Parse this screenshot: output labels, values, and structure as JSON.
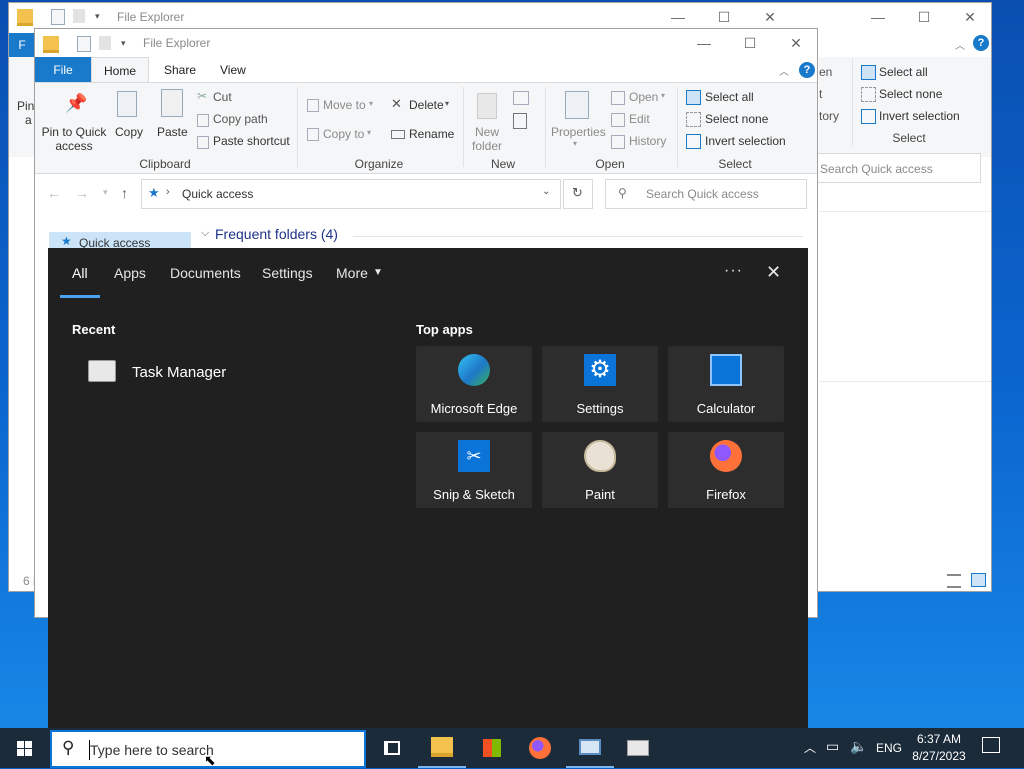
{
  "back_window": {
    "title": "File Explorer",
    "select_group": {
      "select_all": "Select all",
      "select_none": "Select none",
      "invert_selection": "Invert selection",
      "group_label": "Select"
    },
    "search_placeholder": "Search Quick access",
    "partial": {
      "file_tab": "F",
      "pin_part": "Pin",
      "pin_part2": "a",
      "en": "en",
      "t": "t",
      "tory": "tory",
      "status": "6 i"
    }
  },
  "front_window": {
    "title": "File Explorer",
    "tabs": [
      "File",
      "Home",
      "Share",
      "View"
    ],
    "ribbon": {
      "clipboard": {
        "pin": "Pin to Quick access",
        "copy": "Copy",
        "paste": "Paste",
        "cut": "Cut",
        "copy_path": "Copy path",
        "paste_shortcut": "Paste shortcut",
        "label": "Clipboard"
      },
      "organize": {
        "move_to": "Move to",
        "copy_to": "Copy to",
        "delete": "Delete",
        "rename": "Rename",
        "label": "Organize"
      },
      "new": {
        "new_folder": "New folder",
        "label": "New"
      },
      "open": {
        "properties": "Properties",
        "open": "Open",
        "edit": "Edit",
        "history": "History",
        "label": "Open"
      },
      "select": {
        "select_all": "Select all",
        "select_none": "Select none",
        "invert_selection": "Invert selection",
        "label": "Select"
      }
    },
    "address": {
      "location": "Quick access",
      "search_placeholder": "Search Quick access"
    },
    "nav_pane": {
      "quick_access": "Quick access"
    },
    "content": {
      "frequent_folders": "Frequent folders (4)"
    }
  },
  "search_panel": {
    "tabs": [
      "All",
      "Apps",
      "Documents",
      "Settings",
      "More"
    ],
    "recent_heading": "Recent",
    "recent_items": [
      "Task Manager"
    ],
    "top_apps_heading": "Top apps",
    "top_apps": [
      "Microsoft Edge",
      "Settings",
      "Calculator",
      "Snip & Sketch",
      "Paint",
      "Firefox"
    ]
  },
  "taskbar": {
    "search_placeholder": "Type here to search",
    "language": "ENG",
    "time": "6:37 AM",
    "date": "8/27/2023"
  },
  "colors": {
    "accent": "#1979ca",
    "panel_bg": "#202020",
    "tile_bg": "#2d2d2d",
    "taskbar_bg": "#1c2b3a"
  }
}
